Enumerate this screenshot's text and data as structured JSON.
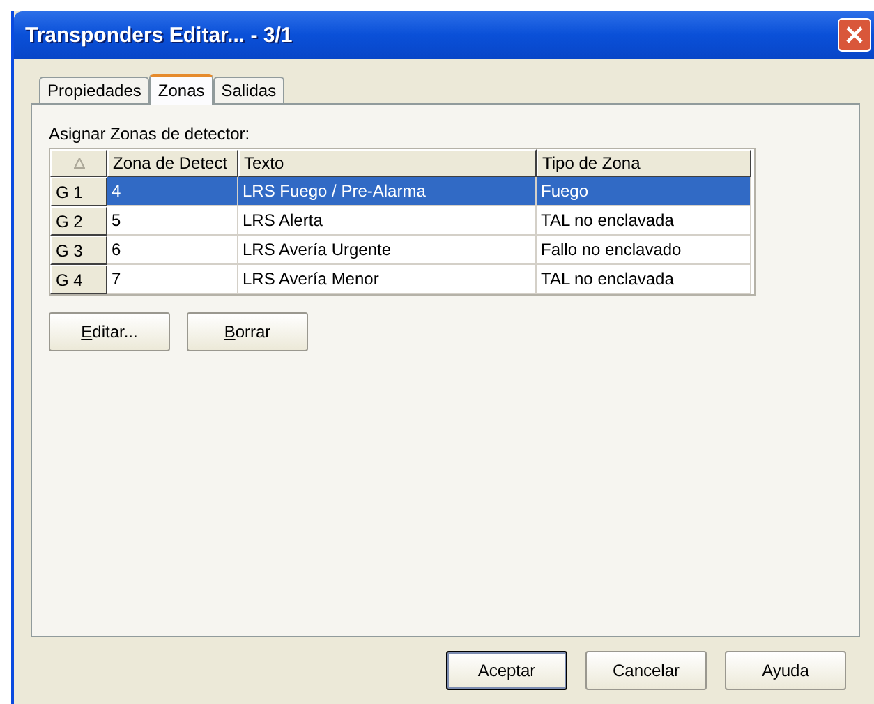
{
  "window": {
    "title": "Transponders Editar... - 3/1"
  },
  "tabs": [
    {
      "label": "Propiedades",
      "selected": false
    },
    {
      "label": "Zonas",
      "selected": true
    },
    {
      "label": "Salidas",
      "selected": false
    }
  ],
  "section_label": "Asignar Zonas de detector:",
  "table": {
    "columns": [
      "Zona de Detect",
      "Texto",
      "Tipo de Zona"
    ],
    "rows": [
      {
        "header": "G 1",
        "cells": [
          "4",
          "LRS Fuego / Pre-Alarma",
          "Fuego"
        ],
        "selected": true
      },
      {
        "header": "G 2",
        "cells": [
          "5",
          "LRS Alerta",
          "TAL no enclavada"
        ],
        "selected": false
      },
      {
        "header": "G 3",
        "cells": [
          "6",
          "LRS Avería Urgente",
          "Fallo no enclavado"
        ],
        "selected": false
      },
      {
        "header": "G 4",
        "cells": [
          "7",
          "LRS Avería Menor",
          "TAL no enclavada"
        ],
        "selected": false
      }
    ]
  },
  "table_buttons": [
    {
      "label": "Editar...",
      "mnemonic_underlined": true
    },
    {
      "label": "Borrar",
      "mnemonic_underlined": true
    }
  ],
  "dialog_buttons": [
    {
      "label": "Aceptar",
      "default": true
    },
    {
      "label": "Cancelar",
      "default": false
    },
    {
      "label": "Ayuda",
      "default": false
    }
  ]
}
